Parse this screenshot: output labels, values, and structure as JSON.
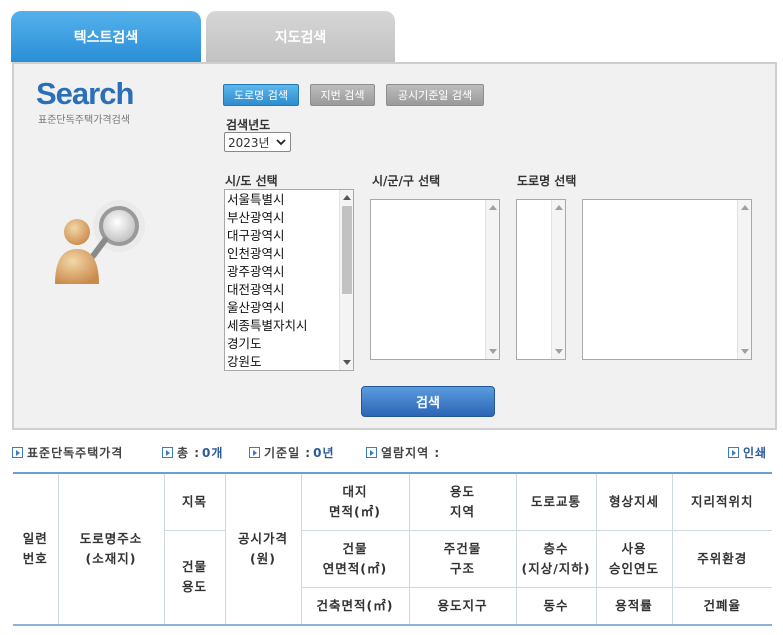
{
  "tabs": [
    {
      "label": "텍스트검색",
      "active": true
    },
    {
      "label": "지도검색",
      "active": false
    }
  ],
  "logo": {
    "title": "Search",
    "subtitle": "표준단독주택가격검색"
  },
  "modes": {
    "road": "도로명 검색",
    "lot": "지번 검색",
    "date": "공시기준일 검색"
  },
  "year": {
    "label": "검색년도",
    "selected": "2023년"
  },
  "columns": {
    "sido": "시/도 선택",
    "sigungu": "시/군/구 선택",
    "road": "도로명 선택"
  },
  "sido_options": [
    "서울특별시",
    "부산광역시",
    "대구광역시",
    "인천광역시",
    "광주광역시",
    "대전광역시",
    "울산광역시",
    "세종특별자치시",
    "경기도",
    "강원도"
  ],
  "search_button": "검색",
  "info": {
    "title": "표준단독주택가격",
    "total_label": "총 :",
    "total_value": "0개",
    "date_label": "기준일 :",
    "date_value": "0년",
    "region_label": "열람지역 :",
    "print": "인쇄"
  },
  "table": {
    "serial": "일련\n번호",
    "address": "도로명주소\n(소재지)",
    "jimok": "지목",
    "bldg_use": "건물\n용도",
    "price": "공시가격\n(원)",
    "land_area": "대지\n면적(㎡)",
    "floor_area": "건물\n연면적(㎡)",
    "build_area": "건축면적(㎡)",
    "zone": "용도\n지역",
    "structure": "주건물\n구조",
    "district": "용도지구",
    "road_traffic": "도로교통",
    "floors": "층수\n(지상/지하)",
    "dong": "동수",
    "shape": "형상지세",
    "use_year": "사용\n승인연도",
    "floor_ratio": "용적률",
    "geo_location": "지리적위치",
    "surroundings": "주위환경",
    "coverage_ratio": "건폐율"
  },
  "colors": {
    "tab_active": "#2a8fd6",
    "panel_bg": "#f1f1f1",
    "accent": "#2d65b4"
  }
}
